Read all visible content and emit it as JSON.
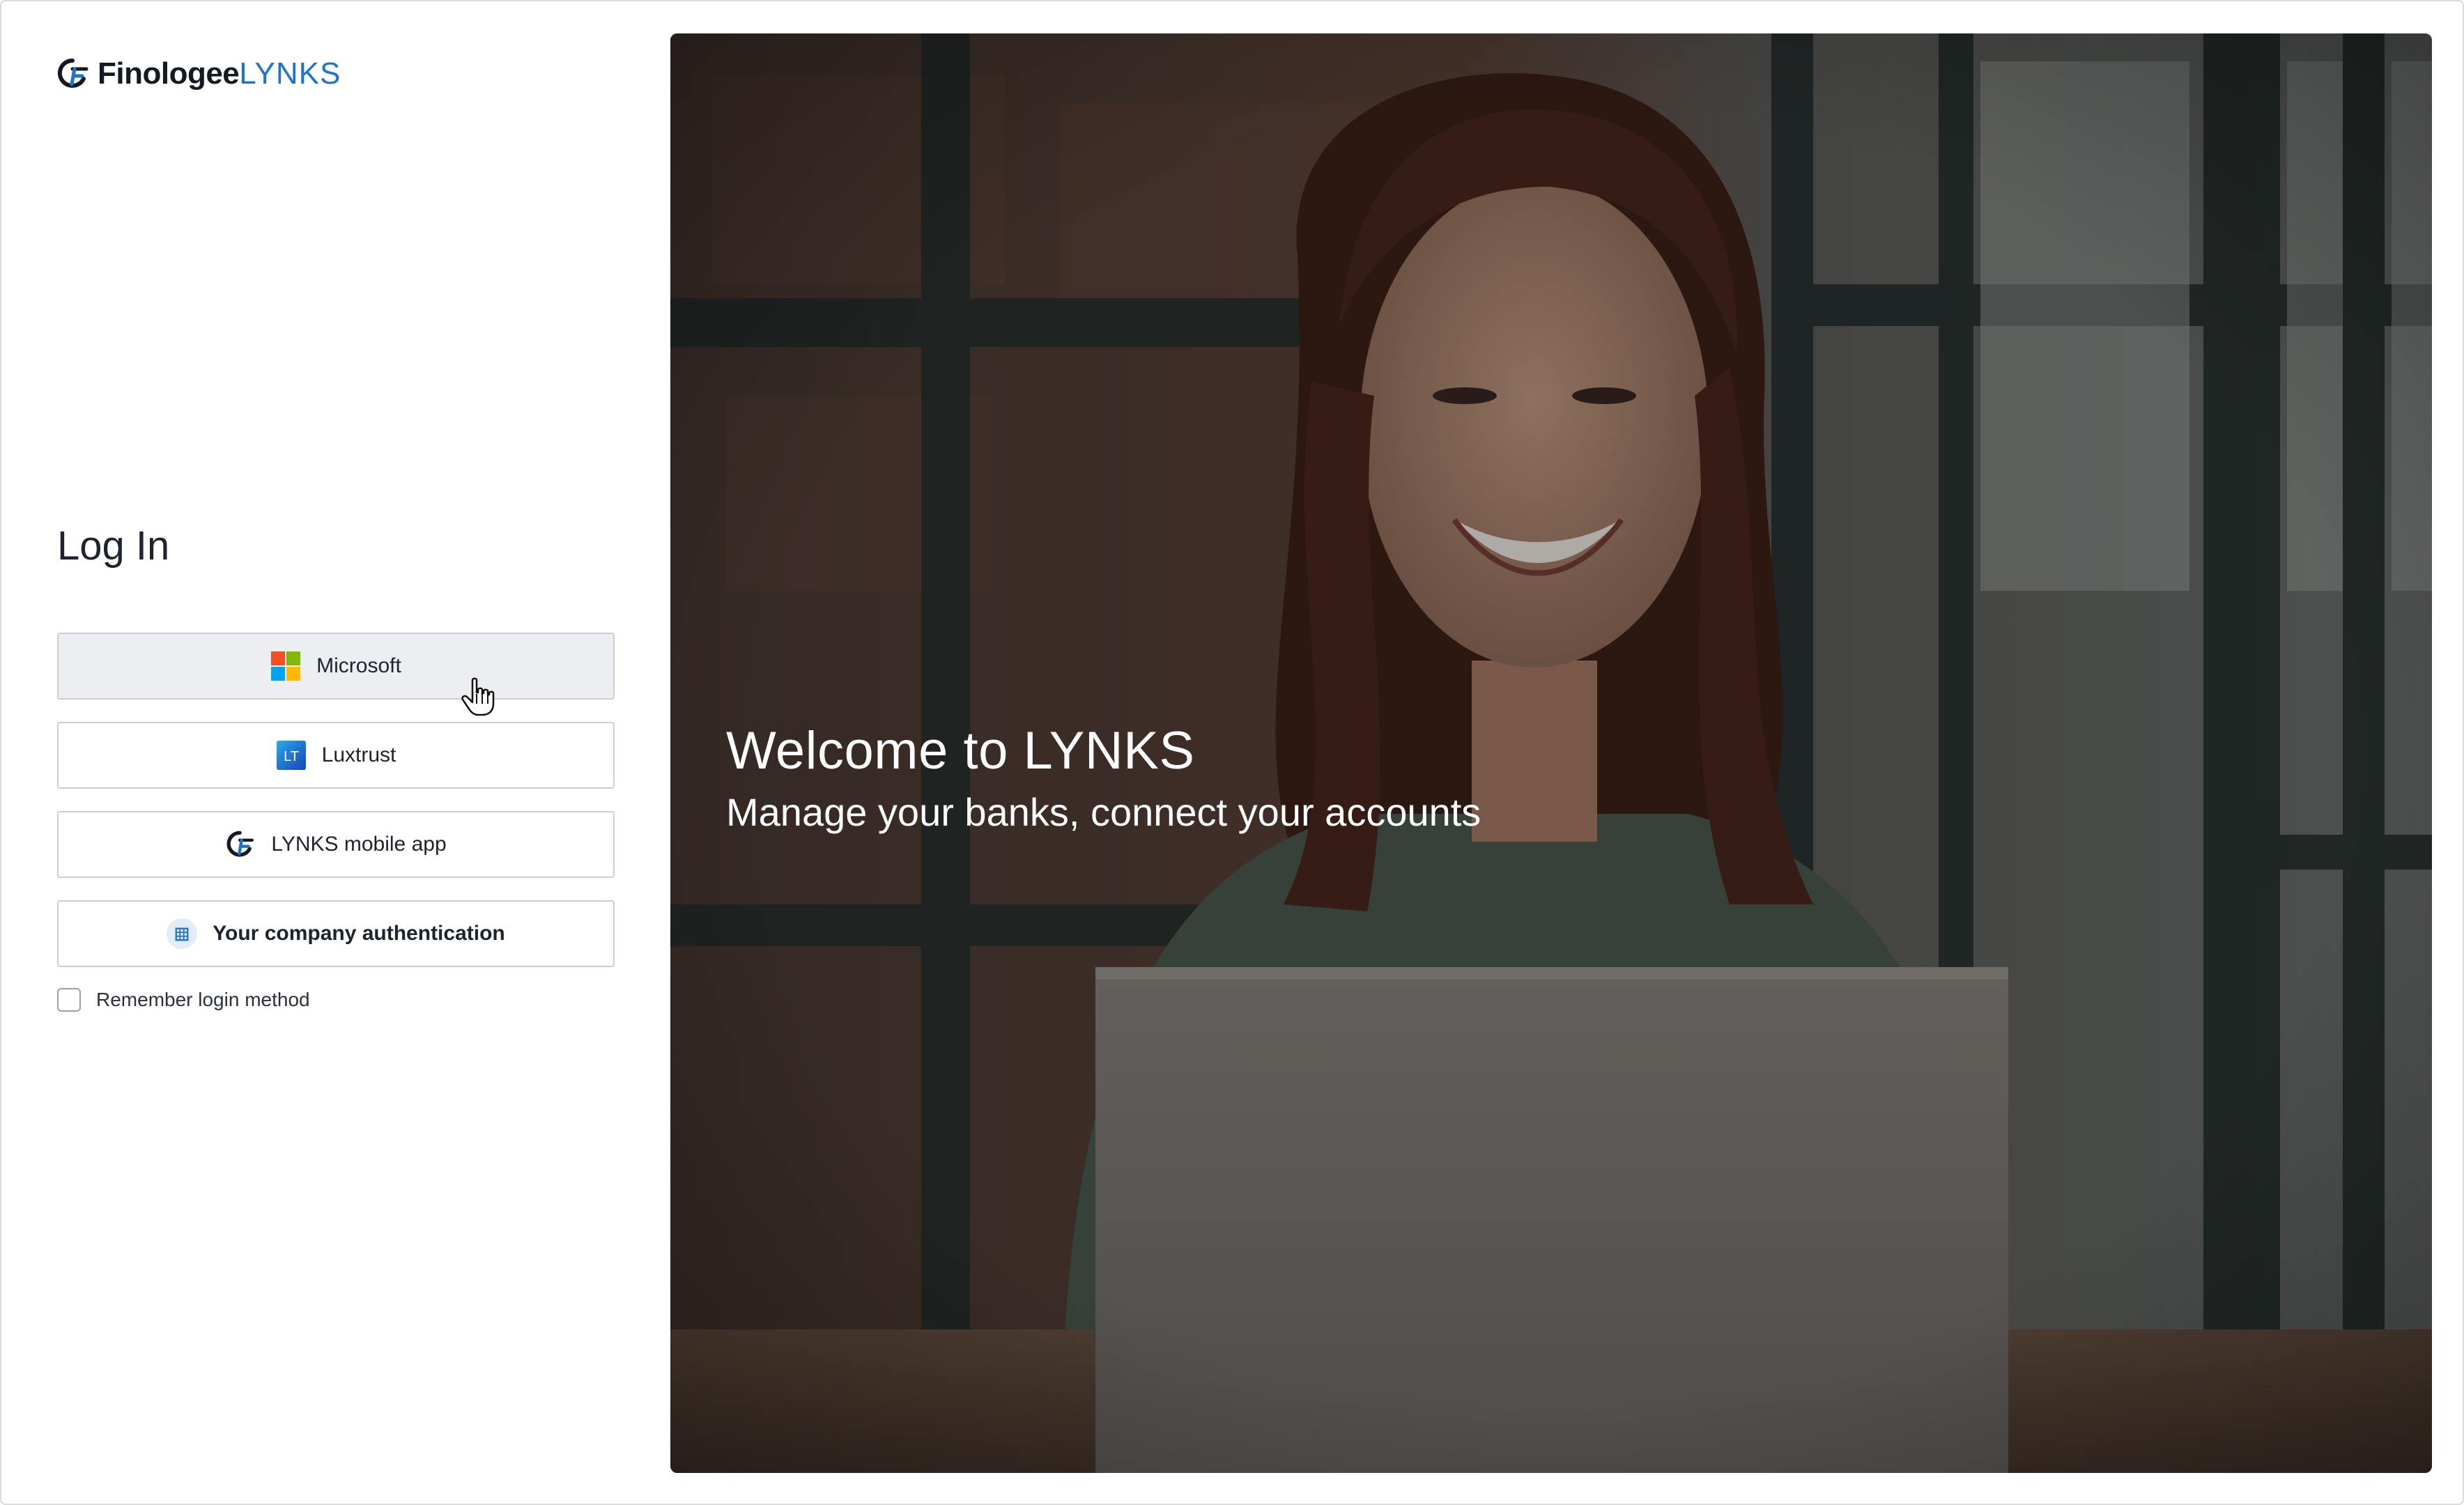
{
  "brand": {
    "name_main": "Finologee",
    "name_accent": "LYNKS",
    "logo_icon": "finologee-logo-icon",
    "accent_color": "#1f74c9"
  },
  "login": {
    "title": "Log In",
    "options": [
      {
        "label": "Microsoft",
        "icon": "microsoft-icon",
        "state": "hover"
      },
      {
        "label": "Luxtrust",
        "icon": "luxtrust-icon",
        "icon_text": "LT"
      },
      {
        "label": "LYNKS mobile app",
        "icon": "finologee-logo-icon"
      },
      {
        "label": "Your company authentication",
        "icon": "building-icon"
      }
    ],
    "remember": {
      "label": "Remember login method",
      "checked": false
    }
  },
  "hero": {
    "title": "Welcome to LYNKS",
    "subtitle": "Manage your banks, connect your accounts",
    "image": "woman-smiling-at-laptop-photo"
  }
}
